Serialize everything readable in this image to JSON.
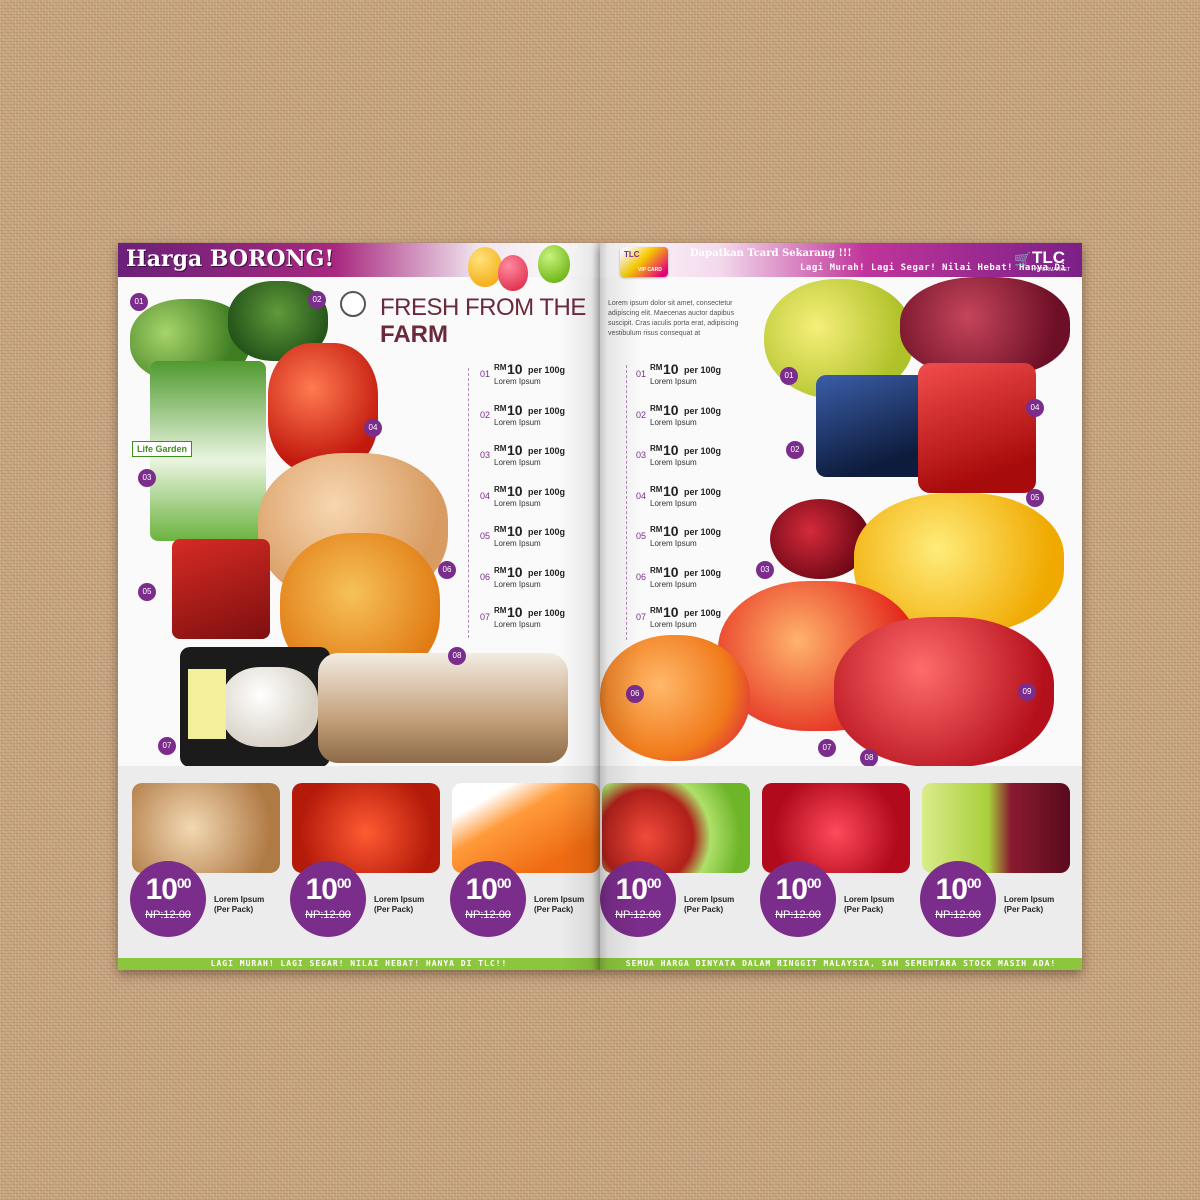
{
  "left_page": {
    "header_title": "Harga BORONG!",
    "title_line1": "FRESH FROM THE",
    "title_line2": "FARM",
    "brand_tag": "Life Garden",
    "product_numbers": [
      "01",
      "02",
      "03",
      "04",
      "05",
      "06",
      "07",
      "08"
    ],
    "price_list": [
      {
        "num": "01",
        "currency": "RM",
        "price": "10",
        "unit": "per 100g",
        "name": "Lorem Ipsum"
      },
      {
        "num": "02",
        "currency": "RM",
        "price": "10",
        "unit": "per 100g",
        "name": "Lorem Ipsum"
      },
      {
        "num": "03",
        "currency": "RM",
        "price": "10",
        "unit": "per 100g",
        "name": "Lorem Ipsum"
      },
      {
        "num": "04",
        "currency": "RM",
        "price": "10",
        "unit": "per 100g",
        "name": "Lorem Ipsum"
      },
      {
        "num": "05",
        "currency": "RM",
        "price": "10",
        "unit": "per 100g",
        "name": "Lorem Ipsum"
      },
      {
        "num": "06",
        "currency": "RM",
        "price": "10",
        "unit": "per 100g",
        "name": "Lorem Ipsum"
      },
      {
        "num": "07",
        "currency": "RM",
        "price": "10",
        "unit": "per 100g",
        "name": "Lorem Ipsum"
      }
    ],
    "deals": [
      {
        "item": "onions",
        "price": "10",
        "cents": "00",
        "old_price": "NP:12.00",
        "name": "Lorem Ipsum",
        "pack": "(Per Pack)"
      },
      {
        "item": "tomatoes",
        "price": "10",
        "cents": "00",
        "old_price": "NP:12.00",
        "name": "Lorem Ipsum",
        "pack": "(Per Pack)"
      },
      {
        "item": "carrots",
        "price": "10",
        "cents": "00",
        "old_price": "NP:12.00",
        "name": "Lorem Ipsum",
        "pack": "(Per Pack)"
      }
    ],
    "footer": "LAGI MURAH! LAGI SEGAR! NILAI HEBAT! HANYA DI TLC!!"
  },
  "right_page": {
    "card_label": "TLC",
    "card_sublabel": "VIP CARD",
    "promo": "Dapatkan Tcard Sekarang !!!",
    "tagline": "Lagi Murah! Lagi Segar! Nilai Hebat! Hanya Di",
    "logo": "TLC",
    "logo_sub": "HYPERMARKET",
    "intro": "Lorem ipsum dolor sit amet, consectetur adipiscing elit. Maecenas auctor dapibus suscipit. Cras iaculis porta erat, adipiscing vestibulum risus consequat at",
    "product_numbers": [
      "01",
      "02",
      "03",
      "04",
      "05",
      "06",
      "07",
      "08",
      "09"
    ],
    "price_list": [
      {
        "num": "01",
        "currency": "RM",
        "price": "10",
        "unit": "per 100g",
        "name": "Lorem Ipsum"
      },
      {
        "num": "02",
        "currency": "RM",
        "price": "10",
        "unit": "per 100g",
        "name": "Lorem Ipsum"
      },
      {
        "num": "03",
        "currency": "RM",
        "price": "10",
        "unit": "per 100g",
        "name": "Lorem Ipsum"
      },
      {
        "num": "04",
        "currency": "RM",
        "price": "10",
        "unit": "per 100g",
        "name": "Lorem Ipsum"
      },
      {
        "num": "05",
        "currency": "RM",
        "price": "10",
        "unit": "per 100g",
        "name": "Lorem Ipsum"
      },
      {
        "num": "06",
        "currency": "RM",
        "price": "10",
        "unit": "per 100g",
        "name": "Lorem Ipsum"
      },
      {
        "num": "07",
        "currency": "RM",
        "price": "10",
        "unit": "per 100g",
        "name": "Lorem Ipsum"
      }
    ],
    "deals": [
      {
        "item": "apples",
        "price": "10",
        "cents": "00",
        "old_price": "NP:12.00",
        "name": "Lorem Ipsum",
        "pack": "(Per Pack)"
      },
      {
        "item": "strawberries",
        "price": "10",
        "cents": "00",
        "old_price": "NP:12.00",
        "name": "Lorem Ipsum",
        "pack": "(Per Pack)"
      },
      {
        "item": "grapes",
        "price": "10",
        "cents": "00",
        "old_price": "NP:12.00",
        "name": "Lorem Ipsum",
        "pack": "(Per Pack)"
      }
    ],
    "footer": "SEMUA HARGA DINYATA DALAM RINGGIT MALAYSIA, SAH SEMENTARA STOCK MASIH ADA!"
  },
  "colors": {
    "accent": "#7b2d8b",
    "footer_green": "#8cc63f",
    "header_magenta": "#c0359b"
  }
}
